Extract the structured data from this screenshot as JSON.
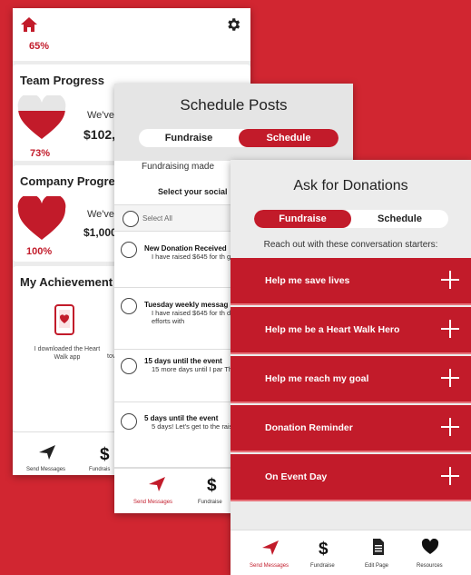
{
  "colors": {
    "brand_red": "#c21b2a",
    "background": "#d12631",
    "panel_gray": "#ececec"
  },
  "screen1": {
    "top_percent": "65%",
    "team": {
      "title": "Team Progress",
      "message": "We've",
      "amount": "$102,",
      "percent": "73%",
      "heart_fill": 0.73
    },
    "company": {
      "title": "Company Progre",
      "message": "We've",
      "amount": "$1,000",
      "percent": "100%",
      "heart_fill": 1.0
    },
    "achievements": {
      "title": "My Achievement",
      "item1": "I downloaded the Heart Walk app",
      "item2": "tov"
    },
    "tabs": [
      {
        "label": "Send Messages",
        "icon": "paper-plane-icon"
      },
      {
        "label": "Fundrais",
        "icon": "dollar-icon"
      }
    ]
  },
  "screen2": {
    "title": "Schedule Posts",
    "segments": [
      "Fundraise",
      "Schedule"
    ],
    "active_segment": "Schedule",
    "subtitle": "Fundraising made",
    "select_social": "Select your social",
    "select_all": "Select All",
    "posts": [
      {
        "title": "New Donation Received",
        "body": "I have raised $645 for th goal of $1000. Support"
      },
      {
        "title": "Tuesday weekly messag",
        "body": "I have raised $645 for th day I am getting closer Support my efforts with"
      },
      {
        "title": "15 days until the event",
        "body": "15 more days until I par There's still time to show donation!"
      },
      {
        "title": "5 days until the event",
        "body": "5 days! Let's get to the raising money and nee"
      }
    ],
    "tabs": [
      {
        "label": "Send Messages",
        "icon": "paper-plane-icon"
      },
      {
        "label": "Fundraise",
        "icon": "dollar-icon"
      }
    ]
  },
  "screen3": {
    "title": "Ask for Donations",
    "segments": [
      "Fundraise",
      "Schedule"
    ],
    "active_segment": "Fundraise",
    "subtitle": "Reach out with these conversation starters:",
    "items": [
      "Help me save lives",
      "Help me be a Heart Walk Hero",
      "Help me reach my goal",
      "Donation Reminder",
      "On Event Day"
    ],
    "tabs": [
      {
        "label": "Send Messages",
        "icon": "paper-plane-icon"
      },
      {
        "label": "Fundraise",
        "icon": "dollar-icon"
      },
      {
        "label": "Edit Page",
        "icon": "document-icon"
      },
      {
        "label": "Resources",
        "icon": "heart-icon"
      }
    ]
  }
}
